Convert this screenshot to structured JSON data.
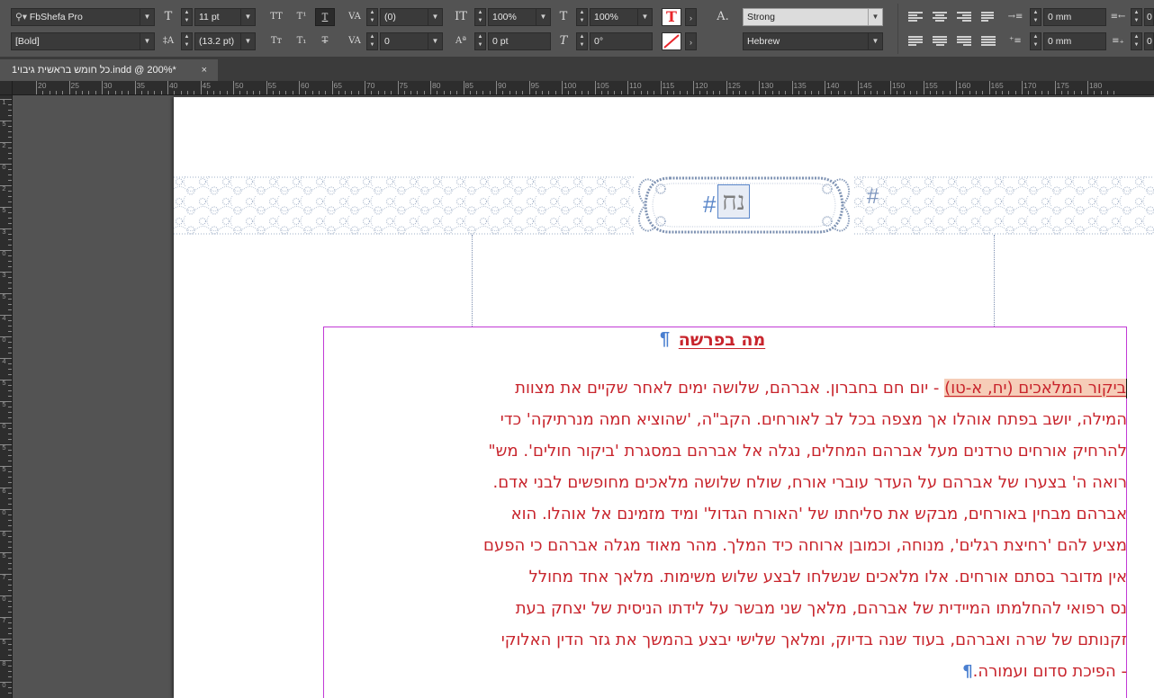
{
  "control_panel": {
    "font_family": "FbShefa Pro",
    "font_style": "[Bold]",
    "font_size": "11 pt",
    "leading": "(13.2 pt)",
    "kerning": "(0)",
    "tracking": "0",
    "vertical_scale": "100%",
    "horizontal_scale": "100%",
    "baseline_shift": "0 pt",
    "skew": "0°",
    "char_style": "Strong",
    "language": "Hebrew",
    "left_indent": "0 mm",
    "space_before": "0 mm",
    "right_edge_1": "0",
    "right_edge_2": "0",
    "colors": {
      "text_fill": "#e8262b"
    }
  },
  "tab": {
    "title": "כל חומש בראשית גיבוי1.indd @ 200%*",
    "close_glyph": "×"
  },
  "ruler": {
    "h_labels": [
      "20",
      "25",
      "30",
      "35",
      "40",
      "45",
      "50",
      "55",
      "60",
      "65",
      "70",
      "75",
      "80",
      "85",
      "90",
      "95",
      "100",
      "105",
      "110",
      "115",
      "120",
      "125",
      "130",
      "135",
      "140",
      "145",
      "150",
      "155",
      "160",
      "165",
      "170",
      "175",
      "180"
    ],
    "v_labels": [
      "1",
      "5",
      "2",
      "0",
      "2",
      "5",
      "3",
      "0",
      "3",
      "5",
      "4",
      "0",
      "4",
      "5",
      "5",
      "0",
      "5",
      "5",
      "6",
      "0",
      "6",
      "5",
      "7",
      "0",
      "7",
      "5",
      "8",
      "0"
    ]
  },
  "page": {
    "chapter_number": "נח",
    "chapter_hash": "#",
    "banner_hash": "#",
    "section_heading": "מה בפרשה",
    "pilcrow": "¶",
    "highlight_text": "ביקור המלאכים (יח, א-טו)",
    "body_lines": [
      "- יום חם בחברון. אברהם, שלושה ימים לאחר שקיים את מצוות",
      "המילה, יושב בפתח אוהלו אך מצפה בכל לב לאורחים. הקב\"ה, 'שהוציא חמה מנרתיקה' כדי",
      "להרחיק אורחים טרדנים מעל אברהם המחלים, נגלה אל אברהם במסגרת 'ביקור חולים'. מש\"",
      "רואה ה' בצערו של אברהם על העדר עוברי אורח, שולח שלושה מלאכים מחופשים לבני אדם.",
      "אברהם מבחין באורחים, מבקש את סליחתו של 'האורח הגדול' ומיד מזמינם אל אוהלו. הוא",
      "מציע להם 'רחיצת רגלים', מנוחה, וכמובן ארוחה כיד המלך. מהר מאוד מגלה אברהם כי הפעם",
      "אין מדובר בסתם אורחים. אלו מלאכים שנשלחו לבצע שלוש משימות. מלאך אחד מחולל",
      "נס רפואי להחלמתו המיידית של אברהם, מלאך שני מבשר על לידתו הניסית של יצחק בעת",
      "זקנותם של שרה ואברהם, בעוד שנה בדיוק, ומלאך שלישי יבצע בהמשך את גזר הדין האלוקי",
      "- הפיכת סדום ועמורה."
    ]
  }
}
